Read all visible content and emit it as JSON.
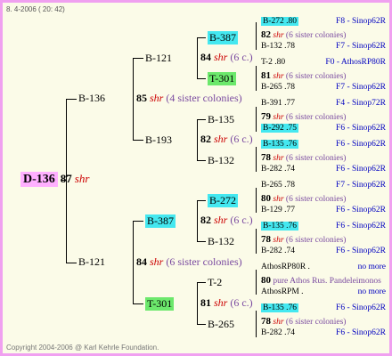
{
  "header": {
    "date": "8. 4-2006 ( 20: 42)"
  },
  "footer": {
    "copyright": "Copyright 2004-2006 @ Karl Kehrle Foundation."
  },
  "shr": "shr",
  "root": {
    "id": "D-136",
    "num": "87"
  },
  "gen1": [
    {
      "id": "B-136"
    },
    {
      "id": "B-121"
    }
  ],
  "gen2": [
    {
      "id": "B-121"
    },
    {
      "id": "B-193"
    },
    {
      "id": "B-387"
    },
    {
      "id": "T-301"
    }
  ],
  "queen_85": {
    "num": "85",
    "note": "(4 sister colonies)"
  },
  "queen_84": {
    "num": "84",
    "note": "(6 sister colonies)"
  },
  "gen3": [
    {
      "id": "B-387"
    },
    {
      "id": "T-301"
    },
    {
      "id": "B-135"
    },
    {
      "id": "B-132"
    },
    {
      "id": "B-272"
    },
    {
      "id": "B-132"
    },
    {
      "id": "T-2"
    },
    {
      "id": "B-265"
    }
  ],
  "q3": [
    {
      "num": "84",
      "note": "(6 c.)"
    },
    {
      "num": "82",
      "note": "(6 c.)"
    },
    {
      "num": "82",
      "note": "(6 c.)"
    },
    {
      "num": "81",
      "note": "(6 c.)"
    }
  ],
  "gen4": [
    {
      "a": "B-272 .80",
      "ar": "F8 - Sinop62R",
      "q": "82",
      "qn": "(6 sister colonies)",
      "b": "B-132 .78",
      "br": "F7 - Sinop62R"
    },
    {
      "a": "T-2 .80",
      "ar": "F0 - AthosRP80R",
      "q": "81",
      "qn": "(6 sister colonies)",
      "b": "B-265 .78",
      "br": "F7 - Sinop62R"
    },
    {
      "a": "B-391 .77",
      "ar": "F4 - Sinop72R",
      "q": "79",
      "qn": "(6 sister colonies)",
      "b": "B-292 .75",
      "br": "F6 - Sinop62R"
    },
    {
      "a": "B-135 .76",
      "ar": "F6 - Sinop62R",
      "q": "78",
      "qn": "(6 sister colonies)",
      "b": "B-282 .74",
      "br": "F6 - Sinop62R"
    },
    {
      "a": "B-265 .78",
      "ar": "F7 - Sinop62R",
      "q": "80",
      "qn": "(6 sister colonies)",
      "b": "B-129 .77",
      "br": "F6 - Sinop62R"
    },
    {
      "a": "B-135 .76",
      "ar": "F6 - Sinop62R",
      "q": "78",
      "qn": "(6 sister colonies)",
      "b": "B-282 .74",
      "br": "F6 - Sinop62R"
    },
    {
      "a": "AthosRP80R .",
      "ar": "no more",
      "q": "80",
      "qn": "pure Athos Rus. Pandeleimonos",
      "b": "AthosRPM .",
      "br": "no more"
    },
    {
      "a": "B-135 .76",
      "ar": "F6 - Sinop62R",
      "q": "78",
      "qn": "(6 sister colonies)",
      "b": "B-282 .74",
      "br": "F6 - Sinop62R"
    }
  ]
}
